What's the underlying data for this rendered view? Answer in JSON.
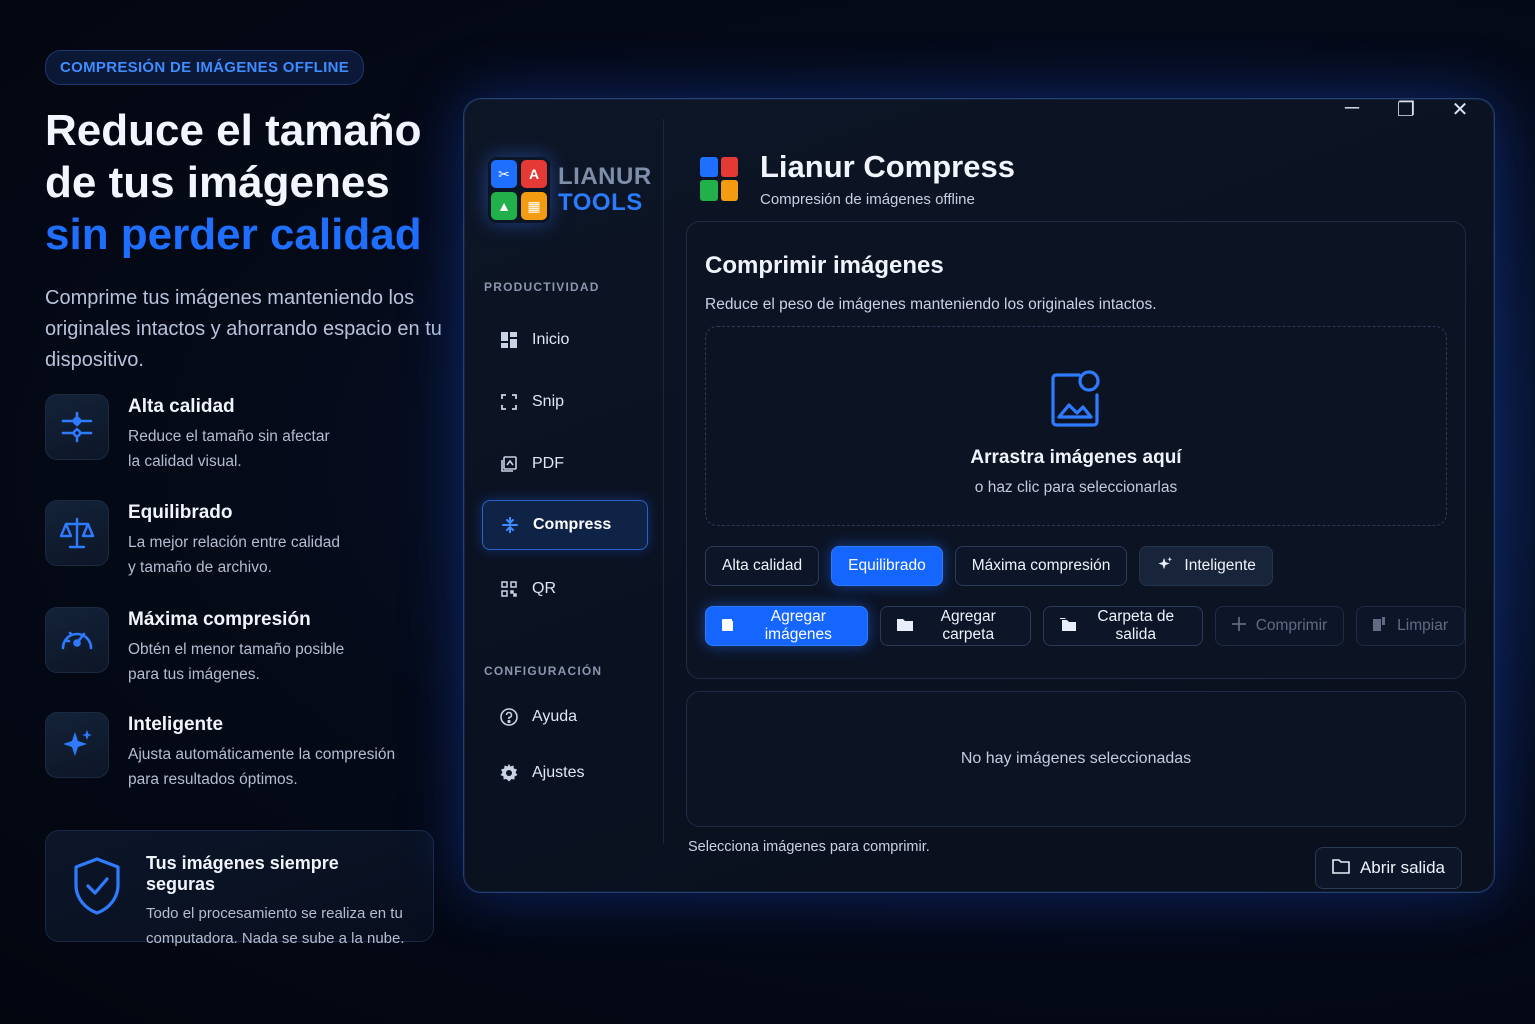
{
  "hero": {
    "pill": "COMPRESIÓN DE IMÁGENES OFFLINE",
    "title_l1": "Reduce el tamaño",
    "title_l2": "de tus imágenes",
    "title_accent": "sin perder calidad",
    "lead": "Comprime tus imágenes manteniendo los originales intactos y ahorrando espacio en tu dispositivo."
  },
  "features": [
    {
      "title": "Alta calidad",
      "desc_l1": "Reduce el tamaño sin afectar",
      "desc_l2": "la calidad visual.",
      "icon": "sliders-icon"
    },
    {
      "title": "Equilibrado",
      "desc_l1": "La mejor relación entre calidad",
      "desc_l2": "y tamaño de archivo.",
      "icon": "balance-scale-icon"
    },
    {
      "title": "Máxima compresión",
      "desc_l1": "Obtén el menor tamaño posible",
      "desc_l2": "para tus imágenes.",
      "icon": "speedometer-icon"
    },
    {
      "title": "Inteligente",
      "desc_l1": "Ajusta automáticamente la compresión",
      "desc_l2": "para resultados óptimos.",
      "icon": "sparkle-icon"
    }
  ],
  "secure": {
    "title": "Tus imágenes siempre seguras",
    "desc_l1": "Todo el procesamiento se realiza en tu",
    "desc_l2": "computadora. Nada se sube a la nube."
  },
  "window": {
    "controls": {
      "minimize": "─",
      "maximize": "❐",
      "close": "✕"
    },
    "logo": {
      "word1": "LIANUR",
      "word2": "TOOLS"
    },
    "sections": {
      "productivity": "PRODUCTIVIDAD",
      "config": "CONFIGURACIÓN"
    },
    "nav": [
      {
        "label": "Inicio",
        "icon": "dashboard-icon"
      },
      {
        "label": "Snip",
        "icon": "snip-icon"
      },
      {
        "label": "PDF",
        "icon": "pdf-icon"
      },
      {
        "label": "Compress",
        "icon": "compress-icon",
        "active": true
      },
      {
        "label": "QR",
        "icon": "qr-icon"
      }
    ],
    "config_nav": [
      {
        "label": "Ayuda",
        "icon": "help-icon"
      },
      {
        "label": "Ajustes",
        "icon": "gear-icon"
      }
    ],
    "header": {
      "title": "Lianur Compress",
      "subtitle": "Compresión de imágenes offline"
    },
    "card": {
      "title": "Comprimir imágenes",
      "desc": "Reduce el peso de imágenes manteniendo los originales intactos.",
      "drop_title": "Arrastra imágenes aquí",
      "drop_sub": "o haz clic para seleccionarlas"
    },
    "modes": [
      {
        "label": "Alta calidad"
      },
      {
        "label": "Equilibrado",
        "selected": true
      },
      {
        "label": "Máxima compresión"
      },
      {
        "label": "Inteligente"
      }
    ],
    "actions": {
      "add_images": "Agregar imágenes",
      "add_folder": "Agregar carpeta",
      "output_folder": "Carpeta de salida",
      "compress": "Comprimir",
      "clear": "Limpiar"
    },
    "empty_list": "No hay imágenes seleccionadas",
    "status": "Selecciona imágenes para comprimir.",
    "open_output": "Abrir salida"
  },
  "colors": {
    "accent": "#1566ff",
    "bg": "#050a18"
  }
}
